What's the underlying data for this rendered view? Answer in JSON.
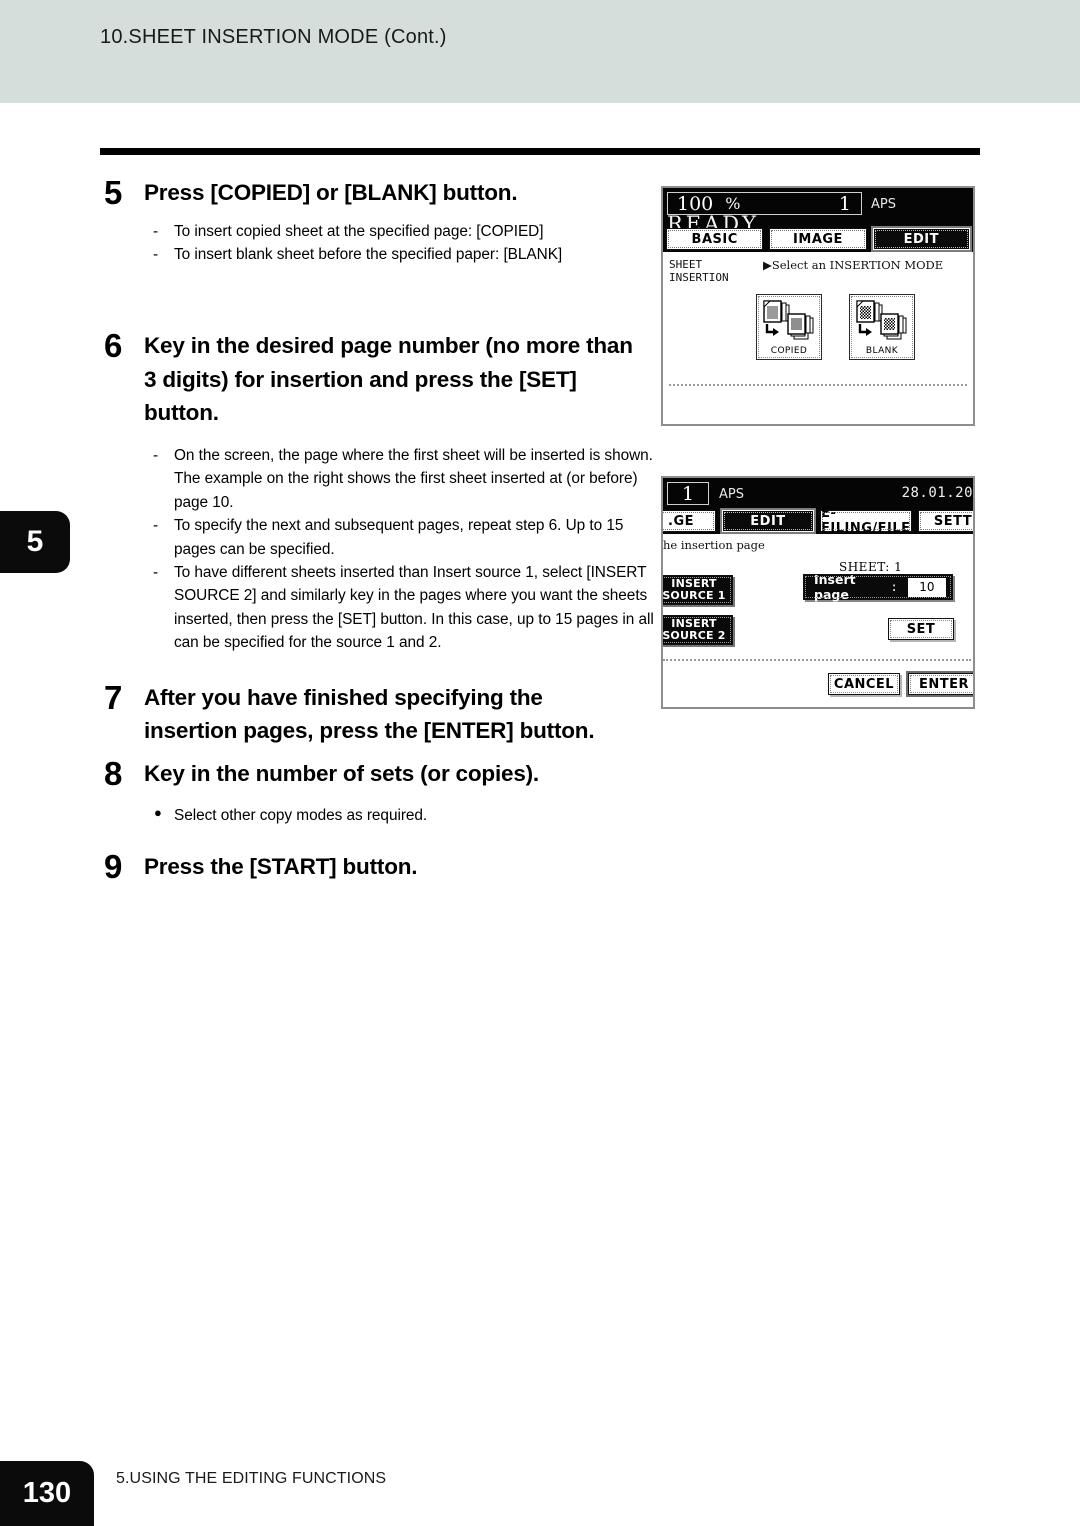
{
  "header": {
    "title": "10.SHEET INSERTION MODE (Cont.)"
  },
  "chapter_tab": {
    "number": "5"
  },
  "steps": [
    {
      "number": "5",
      "title": "Press [COPIED] or [BLANK] button.",
      "bullets": [
        {
          "marker": "-",
          "text": "To insert copied sheet at the specified page: [COPIED]"
        },
        {
          "marker": "-",
          "text": "To insert blank sheet before the specified paper: [BLANK]"
        }
      ]
    },
    {
      "number": "6",
      "title": "Key in the desired page number (no more than 3 digits) for insertion and press the [SET] button.",
      "bullets": [
        {
          "marker": "-",
          "text": "On the screen, the page where the first sheet will be inserted is shown. The example on the right shows the first sheet inserted at (or before) page 10."
        },
        {
          "marker": "-",
          "text": "To specify the next and subsequent pages, repeat step 6. Up to 15 pages can be specified."
        },
        {
          "marker": "-",
          "text": "To have different sheets inserted than Insert source 1, select [INSERT SOURCE 2] and similarly key in the pages where you want the sheets inserted, then press the [SET] button. In this case, up to 15 pages in all can be specified for the source 1 and 2."
        }
      ]
    },
    {
      "number": "7",
      "title": "After you have finished specifying the insertion pages, press the [ENTER] button.",
      "bullets": []
    },
    {
      "number": "8",
      "title": "Key in the number of sets (or copies).",
      "bullets": [
        {
          "marker": "●",
          "text": "Select other copy modes as required."
        }
      ]
    },
    {
      "number": "9",
      "title": "Press the [START] button.",
      "bullets": []
    }
  ],
  "lcd1": {
    "zoom": "100",
    "percent": "%",
    "copies": "1",
    "paper_mode": "APS",
    "status": "READY",
    "tabs": [
      {
        "label": "BASIC",
        "selected": false
      },
      {
        "label": "IMAGE",
        "selected": false
      },
      {
        "label": "EDIT",
        "selected": true
      }
    ],
    "mode_label": "SHEET\nINSERTION",
    "prompt": "▶Select an INSERTION MODE",
    "buttons": [
      {
        "label": "COPIED"
      },
      {
        "label": "BLANK"
      }
    ]
  },
  "lcd2": {
    "copies": "1",
    "paper_mode": "APS",
    "date": "28.01.20",
    "tabs": [
      {
        "label": ".GE",
        "selected": false
      },
      {
        "label": "EDIT",
        "selected": true
      },
      {
        "label": "E-FILING/FILE",
        "selected": false
      },
      {
        "label": "SETT",
        "selected": false
      }
    ],
    "prompt": "he insertion page",
    "sheet_label": "SHEET: 1",
    "source_buttons": [
      {
        "line1": "INSERT",
        "line2": "SOURCE 1"
      },
      {
        "line1": "INSERT",
        "line2": "SOURCE 2"
      }
    ],
    "insert_field": {
      "label": "Insert page",
      "colon": ":",
      "value": "10"
    },
    "set_button": "SET",
    "cancel_button": "CANCEL",
    "enter_button": "ENTER"
  },
  "footer": {
    "page_number": "130",
    "section": "5.USING THE EDITING FUNCTIONS"
  }
}
